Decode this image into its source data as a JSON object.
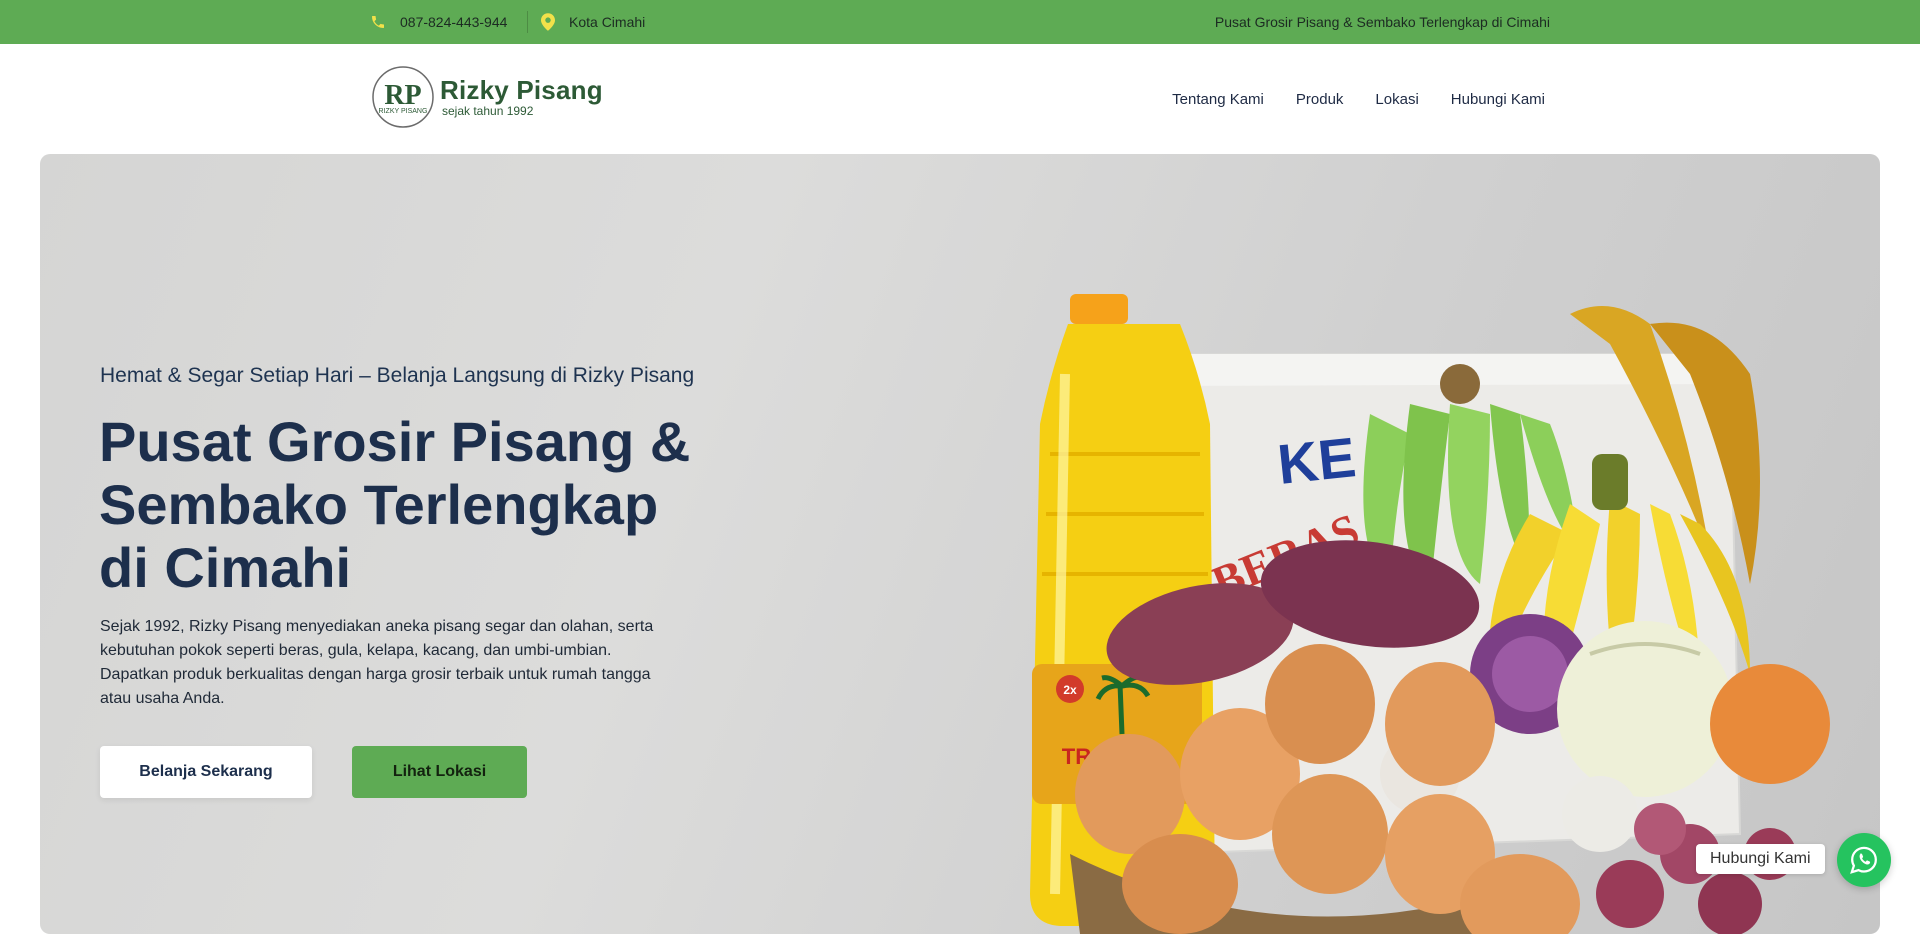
{
  "topbar": {
    "phone": "087-824-443-944",
    "location": "Kota Cimahi",
    "tagline": "Pusat Grosir Pisang & Sembako Terlengkap di Cimahi"
  },
  "header": {
    "logo_mark": "RP",
    "logo_mark_sub": "RIZKY PISANG",
    "logo_name": "Rizky Pisang",
    "logo_sub": "sejak tahun 1992",
    "nav": [
      {
        "label": "Tentang Kami"
      },
      {
        "label": "Produk"
      },
      {
        "label": "Lokasi"
      },
      {
        "label": "Hubungi Kami"
      }
    ]
  },
  "hero": {
    "eyebrow": "Hemat & Segar Setiap Hari – Belanja Langsung di Rizky Pisang",
    "title": "Pusat Grosir Pisang & Sembako Terlengkap di Cimahi",
    "description": "Sejak 1992, Rizky Pisang menyediakan aneka pisang segar dan olahan, serta kebutuhan pokok seperti beras, gula, kelapa, kacang, dan umbi-umbian. Dapatkan produk berkualitas dengan harga grosir terbaik untuk rumah tangga atau usaha Anda.",
    "btn_shop": "Belanja Sekarang",
    "btn_location": "Lihat Lokasi",
    "art_labels": {
      "rice_bag": "KE",
      "rice_word": "BERAS",
      "oil_brand": "TROPICAL",
      "oil_badge": "2x"
    }
  },
  "whatsapp": {
    "label": "Hubungi Kami",
    "icon": "whatsapp-icon"
  },
  "colors": {
    "accent_green": "#5eab54",
    "navy": "#1d2f4c",
    "whatsapp_green": "#25c35f"
  }
}
